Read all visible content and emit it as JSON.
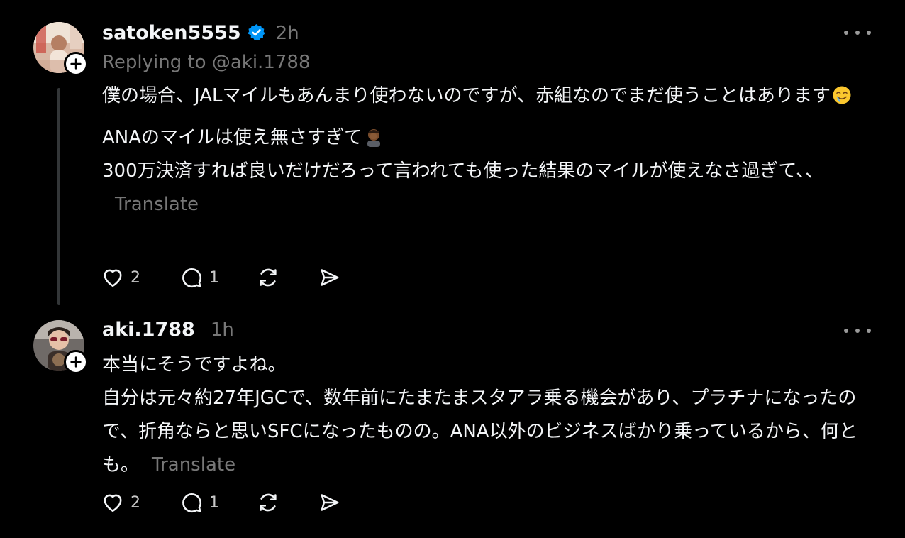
{
  "posts": [
    {
      "username": "satoken5555",
      "verified": true,
      "timestamp": "2h",
      "replying_to": "Replying to @aki.1788",
      "paragraphs": [
        "僕の場合、JALマイルもあんまり使わないのですが、赤組なのでまだ使うことはあります",
        "ANAのマイルは使え無さすぎて",
        "300万決済すれば良いだけだろって言われても使った結果のマイルが使えなさ過ぎて、、"
      ],
      "emojis": [
        "drooling-face-emoji",
        "man-facepalming-emoji"
      ],
      "translate_label": "Translate",
      "likes": "2",
      "replies": "1"
    },
    {
      "username": "aki.1788",
      "verified": false,
      "timestamp": "1h",
      "paragraphs": [
        "本当にそうですよね。",
        "自分は元々約27年JGCで、数年前にたまたまスタアラ乗る機会があり、プラチナになったので、折角ならと思いSFCになったものの。ANA以外のビジネスばかり乗っているから、何とも。"
      ],
      "translate_label": "Translate",
      "likes": "2",
      "replies": "1"
    }
  ],
  "icons": [
    "like-heart-icon",
    "reply-bubble-icon",
    "repost-icon",
    "share-send-icon",
    "more-options-icon",
    "follow-plus-icon",
    "verified-badge-icon"
  ],
  "colors": {
    "background": "#000000",
    "primary_text": "#f3f5f7",
    "secondary_text": "#777777",
    "verified_blue": "#0095f6",
    "thread_line": "#333638"
  }
}
